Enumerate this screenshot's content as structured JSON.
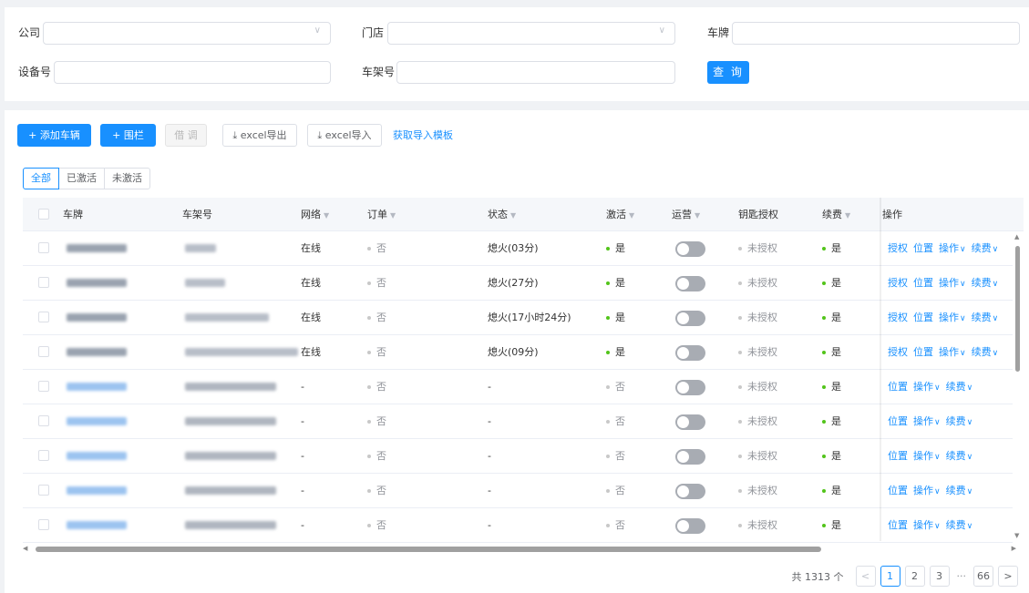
{
  "filters": {
    "company_label": "公司",
    "store_label": "门店",
    "plate_label": "车牌",
    "device_label": "设备号",
    "vin_label": "车架号",
    "query_label": "查 询"
  },
  "toolbar": {
    "add_vehicle": "添加车辆",
    "fence": "围栏",
    "transfer": "借 调",
    "excel_export": "excel导出",
    "excel_import": "excel导入",
    "get_template": "获取导入模板"
  },
  "tabs": [
    "全部",
    "已激活",
    "未激活"
  ],
  "columns": {
    "plate": "车牌",
    "vin": "车架号",
    "network": "网络",
    "order": "订单",
    "status": "状态",
    "activated": "激活",
    "operation": "运营",
    "key_auth": "钥匙授权",
    "renewal": "续费",
    "actions": "操作"
  },
  "rows": [
    {
      "network": "在线",
      "order": "否",
      "status": "熄火(03分)",
      "activated": "是",
      "key_auth": "未授权",
      "renewal": "是",
      "actions": [
        "授权",
        "位置",
        "操作",
        "续费"
      ]
    },
    {
      "network": "在线",
      "order": "否",
      "status": "熄火(27分)",
      "activated": "是",
      "key_auth": "未授权",
      "renewal": "是",
      "actions": [
        "授权",
        "位置",
        "操作",
        "续费"
      ]
    },
    {
      "network": "在线",
      "order": "否",
      "status": "熄火(17小时24分)",
      "activated": "是",
      "key_auth": "未授权",
      "renewal": "是",
      "actions": [
        "授权",
        "位置",
        "操作",
        "续费"
      ]
    },
    {
      "network": "在线",
      "order": "否",
      "status": "熄火(09分)",
      "activated": "是",
      "key_auth": "未授权",
      "renewal": "是",
      "actions": [
        "授权",
        "位置",
        "操作",
        "续费"
      ]
    },
    {
      "network": "-",
      "order": "否",
      "status": "-",
      "activated": "否",
      "key_auth": "未授权",
      "renewal": "是",
      "actions": [
        "位置",
        "操作",
        "续费"
      ]
    },
    {
      "network": "-",
      "order": "否",
      "status": "-",
      "activated": "否",
      "key_auth": "未授权",
      "renewal": "是",
      "actions": [
        "位置",
        "操作",
        "续费"
      ]
    },
    {
      "network": "-",
      "order": "否",
      "status": "-",
      "activated": "否",
      "key_auth": "未授权",
      "renewal": "是",
      "actions": [
        "位置",
        "操作",
        "续费"
      ]
    },
    {
      "network": "-",
      "order": "否",
      "status": "-",
      "activated": "否",
      "key_auth": "未授权",
      "renewal": "是",
      "actions": [
        "位置",
        "操作",
        "续费"
      ]
    },
    {
      "network": "-",
      "order": "否",
      "status": "-",
      "activated": "否",
      "key_auth": "未授权",
      "renewal": "是",
      "actions": [
        "位置",
        "操作",
        "续费"
      ]
    }
  ],
  "pagination": {
    "total": "共 1313 个",
    "pages": [
      "1",
      "2",
      "3"
    ],
    "ellipsis": "···",
    "last": "66",
    "prev": "<",
    "next": ">"
  },
  "colors": {
    "primary": "#1890ff",
    "active_dot": "#52c41a",
    "inactive_dot": "#c8c8c8",
    "plate_blur_online": "#9aa3b0",
    "plate_blur_offline": "#9cc4f0"
  },
  "icons": {
    "add": "plus-icon",
    "download": "download-icon",
    "filter": "funnel-icon",
    "dropdown": "chevron-down-icon"
  }
}
